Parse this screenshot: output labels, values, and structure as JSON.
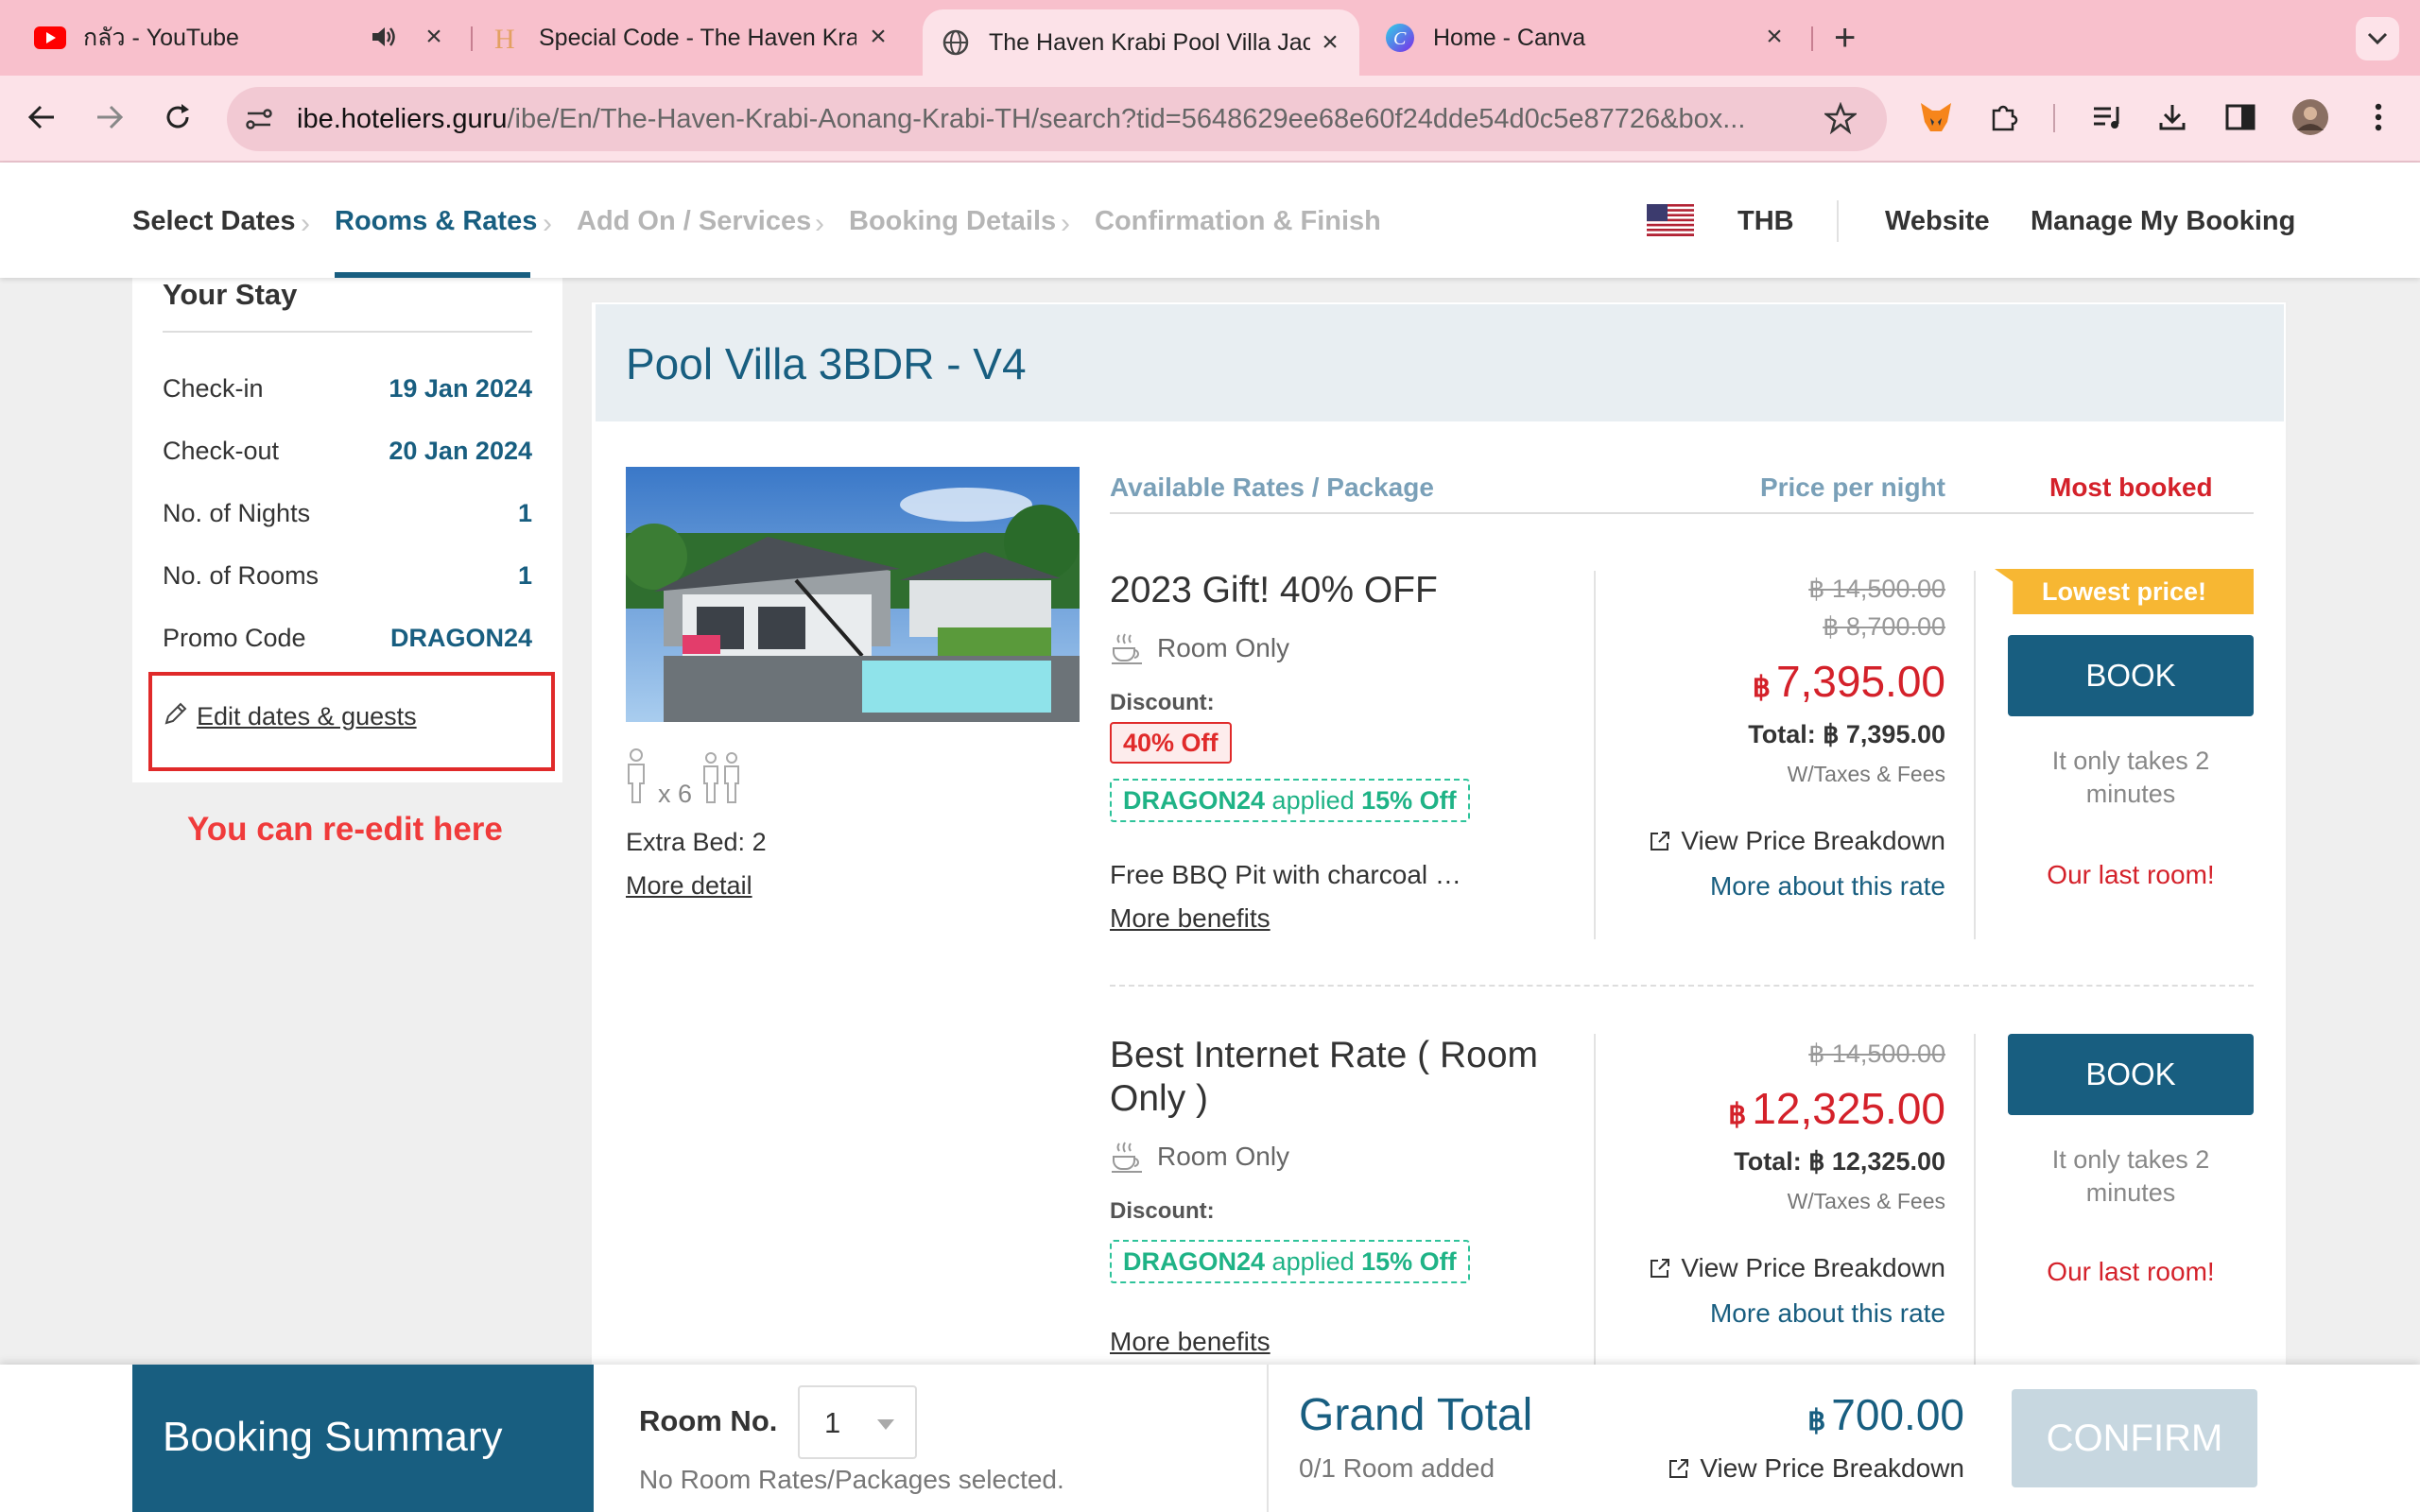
{
  "browser": {
    "tabs": [
      {
        "title": "กลัว - YouTube",
        "has_audio": true
      },
      {
        "title": "Special Code - The Haven Krabi"
      },
      {
        "title": "The Haven Krabi Pool Villa Jacuzzi"
      },
      {
        "title": "Home - Canva"
      }
    ],
    "url_host": "ibe.hoteliers.guru",
    "url_path": "/ibe/En/The-Haven-Krabi-Aonang-Krabi-TH/search?tid=5648629ee68e60f24dde54d0c5e87726&box..."
  },
  "header": {
    "steps": [
      "Select Dates",
      "Rooms & Rates",
      "Add On / Services",
      "Booking Details",
      "Confirmation & Finish"
    ],
    "currency": "THB",
    "website": "Website",
    "manage_booking": "Manage My Booking"
  },
  "stay": {
    "title": "Your Stay",
    "rows": [
      {
        "label": "Check-in",
        "value": "19 Jan 2024"
      },
      {
        "label": "Check-out",
        "value": "20 Jan 2024"
      },
      {
        "label": "No. of Nights",
        "value": "1"
      },
      {
        "label": "No. of Rooms",
        "value": "1"
      },
      {
        "label": "Promo Code",
        "value": "DRAGON24"
      }
    ],
    "edit_link": "Edit dates & guests",
    "annotation": "You can re-edit here"
  },
  "room": {
    "title": "Pool Villa 3BDR - V4",
    "guest_multiplier": "x 6",
    "extra_bed": "Extra Bed: 2",
    "more_detail": "More detail",
    "columns": {
      "package": "Available Rates / Package",
      "price": "Price per night",
      "most_booked": "Most booked"
    },
    "rates": [
      {
        "name": "2023 Gift! 40% OFF",
        "meal": "Room Only",
        "discount_label": "Discount:",
        "off_badge": "40% Off",
        "promo_code": "DRAGON24",
        "promo_applied": "applied",
        "promo_pct": "15% Off",
        "benefit": "Free BBQ Pit with charcoal …",
        "more_benefits": "More benefits",
        "strike_prices": [
          "฿ 14,500.00",
          "฿ 8,700.00"
        ],
        "currency_symbol": "฿",
        "price": "7,395.00",
        "total": "Total: ฿ 7,395.00",
        "taxes": "W/Taxes & Fees",
        "view_breakdown": "View Price Breakdown",
        "more_about": "More about this rate",
        "ribbon": "Lowest price!",
        "book": "BOOK",
        "only_takes": "It only takes 2 minutes",
        "last_room": "Our last room!"
      },
      {
        "name": "Best Internet Rate ( Room Only )",
        "meal": "Room Only",
        "discount_label": "Discount:",
        "promo_code": "DRAGON24",
        "promo_applied": "applied",
        "promo_pct": "15% Off",
        "more_benefits": "More benefits",
        "strike_prices": [
          "฿ 14,500.00"
        ],
        "currency_symbol": "฿",
        "price": "12,325.00",
        "total": "Total: ฿ 12,325.00",
        "taxes": "W/Taxes & Fees",
        "view_breakdown": "View Price Breakdown",
        "more_about": "More about this rate",
        "book": "BOOK",
        "only_takes": "It only takes 2 minutes",
        "last_room": "Our last room!"
      }
    ]
  },
  "summary": {
    "title": "Booking Summary",
    "room_no_label": "Room No.",
    "room_no_value": "1",
    "no_rates": "No Room Rates/Packages selected.",
    "grand_total_label": "Grand Total",
    "rooms_added": "0/1 Room added",
    "currency_symbol": "฿",
    "grand_total": "700.00",
    "view_breakdown": "View Price Breakdown",
    "confirm": "CONFIRM"
  },
  "colors": {
    "brand": "#185e80",
    "price_red": "#d4212a",
    "promo_green": "#1fb386",
    "ribbon_orange": "#f7b733",
    "tab_bar": "#f8c0cc"
  }
}
